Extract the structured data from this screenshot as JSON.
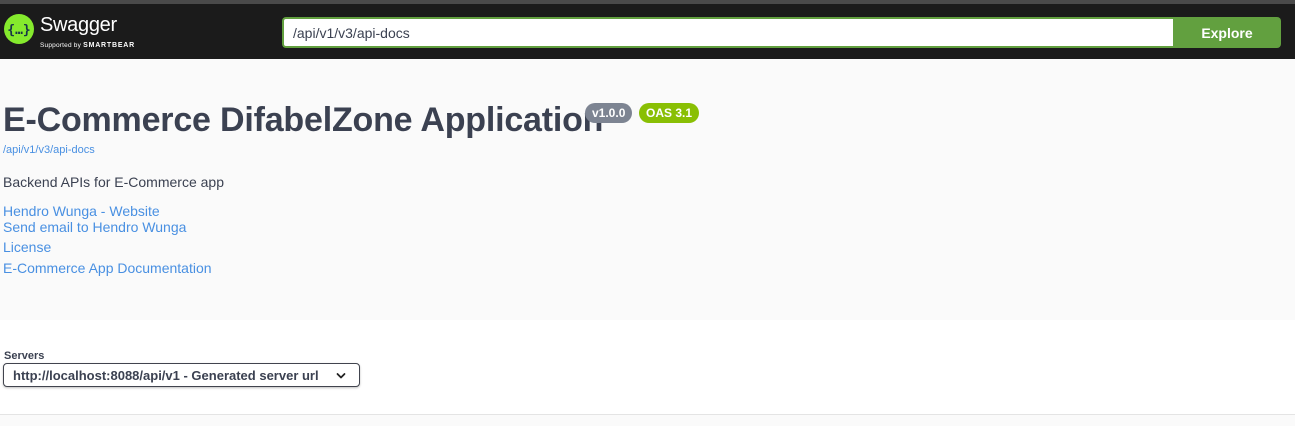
{
  "header": {
    "logo_text": "Swagger",
    "logo_sub_prefix": "Supported by",
    "logo_sub_brand": "SMARTBEAR",
    "url_value": "/api/v1/v3/api-docs",
    "explore_label": "Explore"
  },
  "info": {
    "title": "E-Commerce DifabelZone Application",
    "version_badge": "v1.0.0",
    "oas_badge": "OAS 3.1",
    "docs_link": "/api/v1/v3/api-docs",
    "description": "Backend APIs for E-Commerce app",
    "links": {
      "website": "Hendro Wunga - Website",
      "email": "Send email to Hendro Wunga",
      "license": "License",
      "docs": "E-Commerce App Documentation"
    }
  },
  "servers": {
    "label": "Servers",
    "selected": "http://localhost:8088/api/v1 - Generated server url"
  },
  "colors": {
    "topbar": "#1b1b1b",
    "accent_green": "#62a03f",
    "link_blue": "#4990e2",
    "version_badge": "#7d8492",
    "oas_badge": "#89bf04",
    "logo_green": "#85ea2d"
  },
  "icons": {
    "logo": "swagger-logo-icon",
    "dropdown": "chevron-down-icon"
  }
}
